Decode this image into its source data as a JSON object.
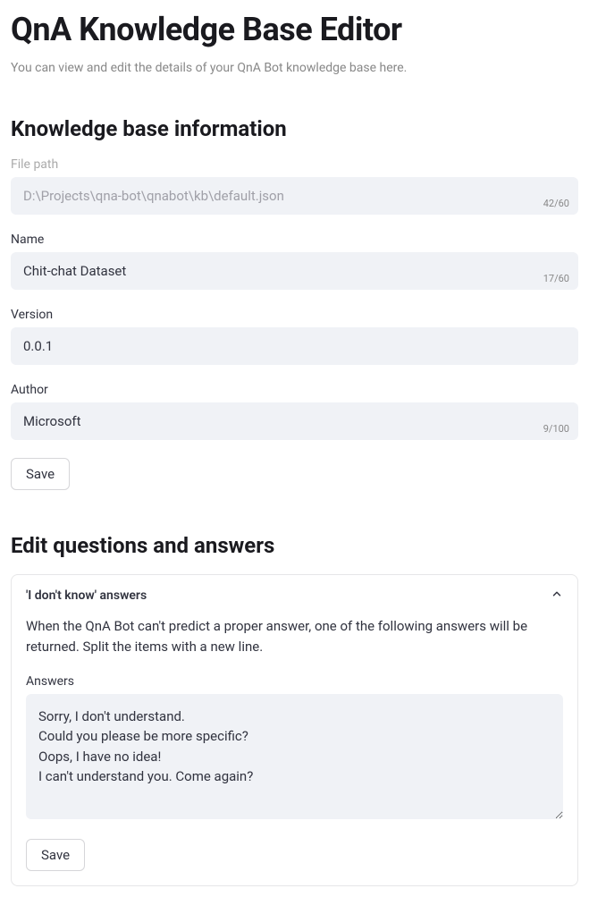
{
  "page": {
    "title": "QnA Knowledge Base Editor",
    "subtitle": "You can view and edit the details of your QnA Bot knowledge base here."
  },
  "kb_info": {
    "heading": "Knowledge base information",
    "file_path": {
      "label": "File path",
      "value": "D:\\Projects\\qna-bot\\qnabot\\kb\\default.json",
      "counter": "42/60"
    },
    "name": {
      "label": "Name",
      "value": "Chit-chat Dataset",
      "counter": "17/60"
    },
    "version": {
      "label": "Version",
      "value": "0.0.1"
    },
    "author": {
      "label": "Author",
      "value": "Microsoft",
      "counter": "9/100"
    },
    "save_label": "Save"
  },
  "qa_edit": {
    "heading": "Edit questions and answers",
    "expander": {
      "title": "'I don't know' answers",
      "description": "When the QnA Bot can't predict a proper answer, one of the following answers will be returned. Split the items with a new line.",
      "answers_label": "Answers",
      "answers_value": "Sorry, I don't understand.\nCould you please be more specific?\nOops, I have no idea!\nI can't understand you. Come again?",
      "save_label": "Save"
    }
  }
}
